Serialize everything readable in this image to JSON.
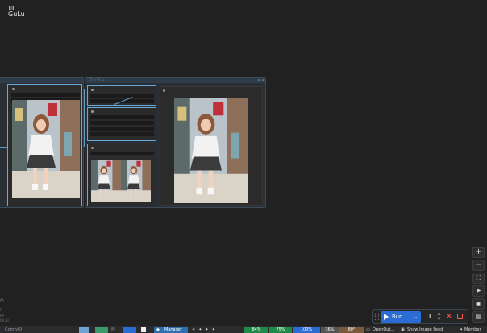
{
  "logo": {
    "text": "GuLu"
  },
  "canvas": {
    "accent_color": "#5d9ec9",
    "group_title": "ランダム"
  },
  "left_panel_labels": [
    "PA",
    "FI",
    "PR",
    "CA,BI"
  ],
  "right_toolbar": {
    "zoom_in": "+",
    "zoom_out": "−",
    "fit": "⛶",
    "locate": "➤",
    "toggle_visibility": "◉",
    "gallery": "▤"
  },
  "run_bar": {
    "run_label": "Run",
    "caret": "⌄",
    "batch_count": "1",
    "stepper_up": "▲",
    "stepper_down": "▼",
    "cancel": "✕"
  },
  "taskbar": {
    "left_text": "ComfyUI",
    "manager_label": "Manager",
    "stats": [
      "84%",
      "75%",
      "100%",
      "36%",
      "80°"
    ],
    "open_out_label": "OpenOut...",
    "image_feed_label": "Show Image Feed",
    "member_label": "Member"
  }
}
